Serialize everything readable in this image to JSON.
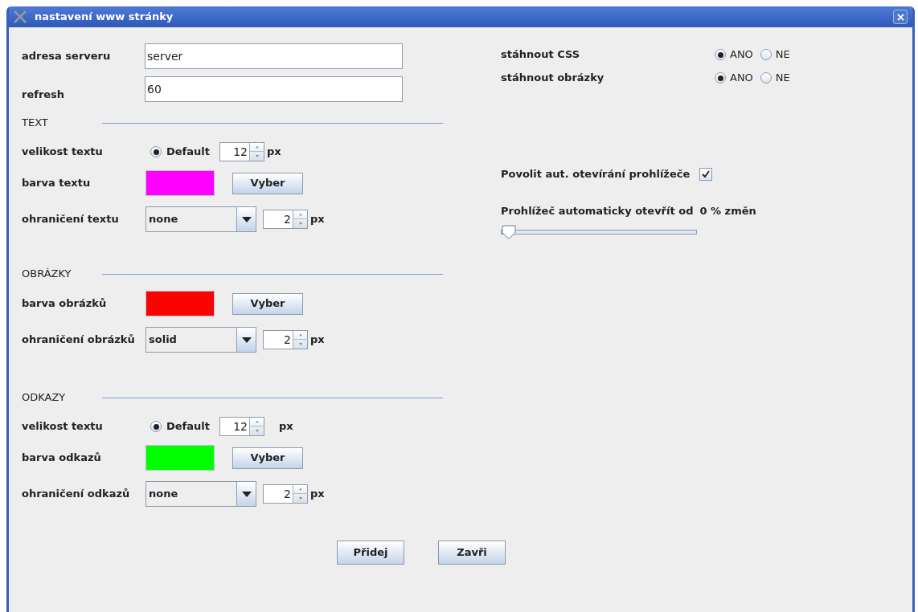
{
  "window": {
    "title": "nastavení www stránky"
  },
  "server": [
    {
      "label": "adresa serveru",
      "value": "server"
    },
    {
      "label": "refresh",
      "value": "60"
    }
  ],
  "sections": [
    {
      "title": "TEXT",
      "rows": [
        {
          "kind": "size",
          "label": "velikost textu",
          "option": "Default",
          "selected": true,
          "value": "12",
          "unit": "px"
        },
        {
          "kind": "color",
          "label": "barva textu",
          "color": "#ff00ff",
          "button": "Vyber"
        },
        {
          "kind": "border",
          "label": "ohraničení textu",
          "style": "none",
          "value": "2",
          "unit": "px"
        }
      ]
    },
    {
      "title": "OBRÁZKY",
      "rows": [
        {
          "kind": "color",
          "label": "barva obrázků",
          "color": "#ff0000",
          "button": "Vyber"
        },
        {
          "kind": "border",
          "label": "ohraničení obrázků",
          "style": "solid",
          "value": "2",
          "unit": "px"
        }
      ]
    },
    {
      "title": "ODKAZY",
      "rows": [
        {
          "kind": "size",
          "label": "velikost textu",
          "option": "Default",
          "selected": true,
          "value": "12",
          "unit": "px"
        },
        {
          "kind": "color",
          "label": "barva odkazů",
          "color": "#00ff00",
          "button": "Vyber"
        },
        {
          "kind": "border",
          "label": "ohraničení odkazů",
          "style": "none",
          "value": "2",
          "unit": "px"
        }
      ]
    }
  ],
  "downloads": [
    {
      "label": "stáhnout CSS",
      "options": [
        {
          "label": "ANO",
          "selected": true
        },
        {
          "label": "NE",
          "selected": false
        }
      ]
    },
    {
      "label": "stáhnout obrázky",
      "options": [
        {
          "label": "ANO",
          "selected": true
        },
        {
          "label": "NE",
          "selected": false
        }
      ]
    }
  ],
  "auto_open": {
    "label": "Povolit aut. otevírání prohlížeče",
    "checked": true
  },
  "threshold": {
    "label": "Prohlížeč automaticky otevřít od",
    "reading": "0 % změn",
    "level": 0
  },
  "buttons": [
    "Přidej",
    "Zavři"
  ]
}
